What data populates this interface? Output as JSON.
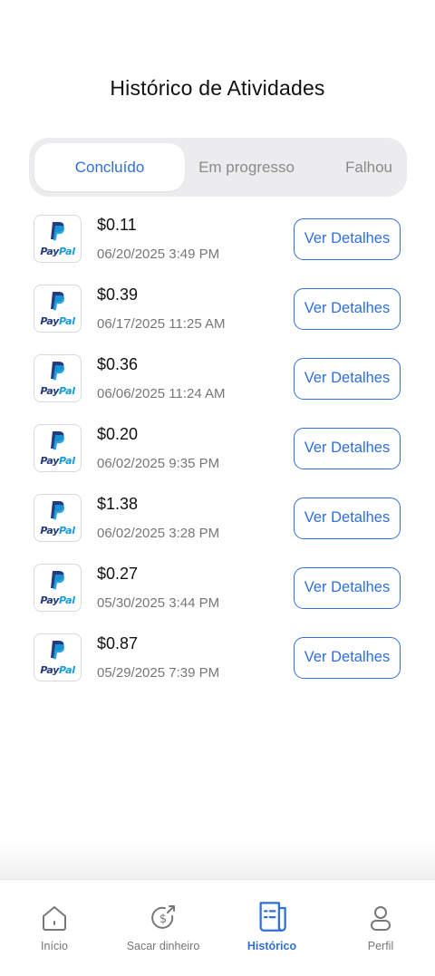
{
  "header": {
    "title": "Histórico de Atividades"
  },
  "tabs": [
    {
      "label": "Concluído",
      "active": true
    },
    {
      "label": "Em progresso",
      "active": false
    },
    {
      "label": "Falhou",
      "active": false
    }
  ],
  "transactions": [
    {
      "provider": "PayPal",
      "amount": "$0.11",
      "date": "06/20/2025 3:49 PM",
      "button": "Ver Detalhes"
    },
    {
      "provider": "PayPal",
      "amount": "$0.39",
      "date": "06/17/2025 11:25 AM",
      "button": "Ver Detalhes"
    },
    {
      "provider": "PayPal",
      "amount": "$0.36",
      "date": "06/06/2025 11:24 AM",
      "button": "Ver Detalhes"
    },
    {
      "provider": "PayPal",
      "amount": "$0.20",
      "date": "06/02/2025 9:35 PM",
      "button": "Ver Detalhes"
    },
    {
      "provider": "PayPal",
      "amount": "$1.38",
      "date": "06/02/2025 3:28 PM",
      "button": "Ver Detalhes"
    },
    {
      "provider": "PayPal",
      "amount": "$0.27",
      "date": "05/30/2025 3:44 PM",
      "button": "Ver Detalhes"
    },
    {
      "provider": "PayPal",
      "amount": "$0.87",
      "date": "05/29/2025 7:39 PM",
      "button": "Ver Detalhes"
    }
  ],
  "bottom_nav": [
    {
      "label": "Início",
      "icon": "home-icon",
      "active": false
    },
    {
      "label": "Sacar dinheiro",
      "icon": "cash-withdraw-icon",
      "active": false
    },
    {
      "label": "Histórico",
      "icon": "receipt-icon",
      "active": true
    },
    {
      "label": "Perfil",
      "icon": "user-icon",
      "active": false
    }
  ],
  "colors": {
    "accent": "#2f6fd9",
    "paypal_dark": "#253b80",
    "paypal_light": "#179bd7"
  }
}
